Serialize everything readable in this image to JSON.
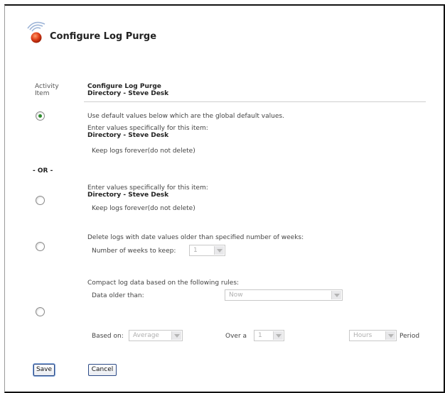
{
  "header": {
    "title": "Configure Log Purge"
  },
  "columns": {
    "activity_item_line1": "Activity",
    "activity_item_line2": "Item",
    "heading_line1": "Configure Log Purge",
    "heading_line2": "Directory - Steve Desk"
  },
  "options": {
    "default": {
      "text": "Use default values below which are the global default values.",
      "enter_values": "Enter values specifically for this item:",
      "item_name": "Directory  - Steve Desk",
      "keep_logs": "Keep logs forever(do not delete)",
      "selected": true
    },
    "or_label": "- OR -",
    "keep_forever": {
      "enter_values": "Enter values specifically for this item:",
      "item_name": "Directory - Steve Desk",
      "keep_logs": "Keep logs forever(do not delete)",
      "selected": false
    },
    "delete_weeks": {
      "text": "Delete logs with date values older than specified number of weeks:",
      "weeks_label": "Number of weeks to keep:",
      "weeks_value": "1",
      "selected": false
    },
    "compact": {
      "text": "Compact log data based on the following rules:",
      "older_than_label": "Data older than:",
      "older_than_value": "Now",
      "based_on_label": "Based on:",
      "based_on_value": "Average",
      "over_label": "Over a",
      "over_value": "1",
      "unit_value": "Hours",
      "period_label": "Period",
      "selected": false
    }
  },
  "buttons": {
    "save": "Save",
    "cancel": "Cancel"
  },
  "colors": {
    "accent_radio": "#2e8b2e",
    "button_border": "#2c4a86"
  }
}
